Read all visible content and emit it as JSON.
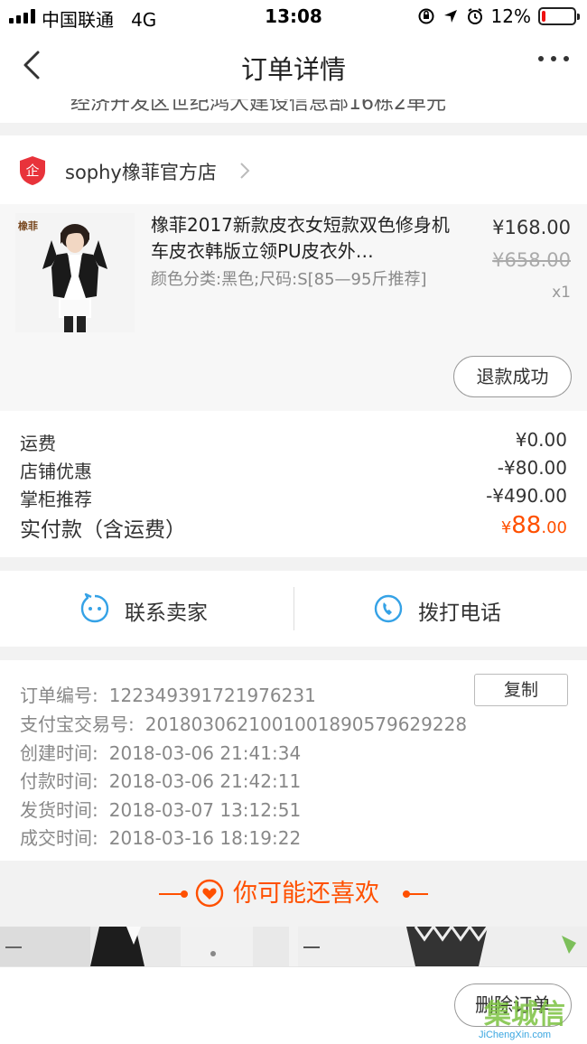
{
  "status_bar": {
    "carrier": "中国联通",
    "network": "4G",
    "time": "13:08",
    "battery_percent": "12%",
    "battery_level": 0.12,
    "battery_color": "#ee1111"
  },
  "nav": {
    "title": "订单详情",
    "back_icon": "chevron-left-icon",
    "more_icon": "more-dots-icon"
  },
  "address_fragment": "经济开发区世纪鸿大建设信息部16栋2单元",
  "shop": {
    "name": "sophy橡菲官方店",
    "logo_icon": "shop-badge-icon",
    "logo_char": "企"
  },
  "item": {
    "thumb_brand": "橡菲",
    "title": "橡菲2017新款皮衣女短款双色修身机车皮衣韩版立领PU皮衣外…",
    "spec": "颜色分类:黑色;尺码:S[85—95斤推荐]",
    "price_now": "¥168.00",
    "price_old": "¥658.00",
    "qty": "x1",
    "refund_label": "退款成功"
  },
  "fees": {
    "shipping_label": "运费",
    "shipping_value": "¥0.00",
    "store_discount_label": "店铺优惠",
    "store_discount_value": "-¥80.00",
    "shopkeeper_label": "掌柜推荐",
    "shopkeeper_value": "-¥490.00",
    "total_label": "实付款（含运费）",
    "total_currency": "¥",
    "total_int": "88",
    "total_dec": ".00",
    "accent_color": "#ff5000"
  },
  "contact": {
    "seller_label": "联系卖家",
    "seller_icon": "chat-bubble-icon",
    "phone_label": "拨打电话",
    "phone_icon": "phone-icon",
    "icon_color": "#35a2e6"
  },
  "order_info": {
    "order_no_label": "订单编号:",
    "order_no": "122349391721976231",
    "copy_label": "复制",
    "alipay_label": "支付宝交易号:",
    "alipay_no": "2018030621001001890579629228",
    "created_label": "创建时间:",
    "created": "2018-03-06 21:41:34",
    "paid_label": "付款时间:",
    "paid": "2018-03-06 21:42:11",
    "shipped_label": "发货时间:",
    "shipped": "2018-03-07 13:12:51",
    "closed_label": "成交时间:",
    "closed": "2018-03-16 18:19:22"
  },
  "recommend": {
    "label": "你可能还喜欢",
    "icon": "heart-icon"
  },
  "bottom": {
    "delete_label": "删除订单"
  },
  "watermark": {
    "logo_text": "集城信",
    "url": "JiChengXin.com"
  }
}
